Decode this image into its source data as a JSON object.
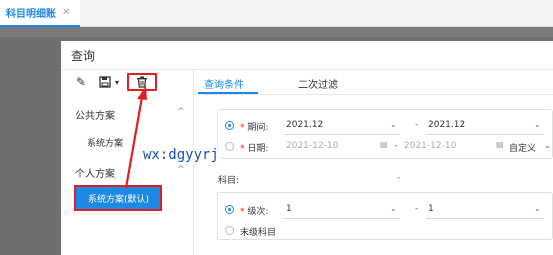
{
  "top_tab": {
    "title": "科目明细账",
    "close": "✕"
  },
  "dialog": {
    "title": "查询",
    "toolbar": {
      "edit": "✎",
      "save": "💾",
      "caret": "▾",
      "delete": "🗑"
    },
    "left": {
      "public_group": "公共方案",
      "public_items": [
        "系统方案"
      ],
      "personal_group": "个人方案",
      "personal_items": [
        "系统方案(默认)"
      ],
      "collapse": "^"
    },
    "tabs": [
      "查询条件",
      "二次过滤"
    ],
    "period": {
      "label": "期间:",
      "from": "2021.12",
      "to": "2021.12",
      "sep": "-"
    },
    "date": {
      "label": "日期:",
      "from": "2021-12-10",
      "to": "2021-12-10",
      "sep": "-",
      "custom": "自定义"
    },
    "subject": {
      "label": "科目:",
      "sep": "-"
    },
    "level": {
      "label": "级次:",
      "from": "1",
      "to": "1",
      "sep": "-",
      "last_level": "末级科目"
    },
    "chevron": "⌄"
  },
  "watermark": "wx:dgyyrj",
  "colors": {
    "accent": "#1e88e5",
    "highlight": "#e02020"
  }
}
